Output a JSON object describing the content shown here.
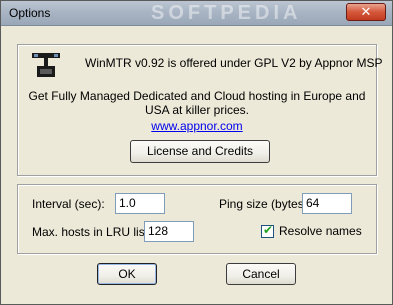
{
  "window": {
    "title": "Options",
    "watermark": "SOFTPEDIA",
    "close_glyph": "✕"
  },
  "about": {
    "offer_text": "WinMTR v0.92 is offered under GPL V2 by Appnor MSP",
    "hosting_line1": "Get Fully Managed Dedicated and Cloud hosting in Europe and",
    "hosting_line2": "USA at killer prices.",
    "link_text": "www.appnor.com",
    "license_button": "License and Credits"
  },
  "settings": {
    "interval_label": "Interval (sec):",
    "interval_value": "1.0",
    "ping_size_label": "Ping size (bytes):",
    "ping_size_value": "64",
    "max_hosts_label": "Max. hosts in LRU list:",
    "max_hosts_value": "128",
    "resolve_names_label": "Resolve names",
    "resolve_names_checked": true
  },
  "buttons": {
    "ok": "OK",
    "cancel": "Cancel"
  },
  "icons": {
    "logo": "winmtr-network-logo-icon",
    "close": "close-icon",
    "check": "checkmark-icon"
  }
}
